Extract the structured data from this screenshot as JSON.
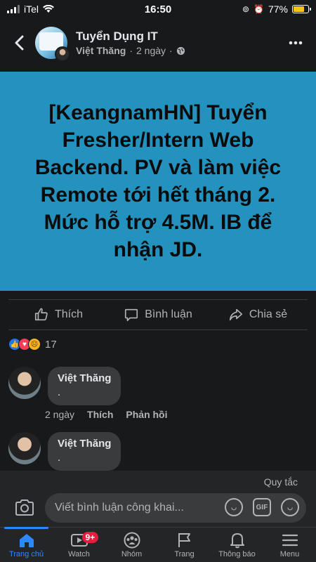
{
  "status_bar": {
    "carrier": "iTel",
    "time": "16:50",
    "battery": "77%",
    "battery_level": 0.77
  },
  "header": {
    "group_name": "Tuyển Dụng IT",
    "author": "Việt Thăng",
    "separator": "·",
    "time_ago": "2 ngày",
    "separator2": "·"
  },
  "post": {
    "text": "[KeangnamHN] Tuyển Fresher/Intern Web Backend. PV và làm việc Remote tới hết tháng 2. Mức hỗ trợ 4.5M. IB để nhận JD.",
    "background_color": "#2492be"
  },
  "actions": {
    "like": "Thích",
    "comment": "Bình luận",
    "share": "Chia sẻ"
  },
  "reactions": {
    "count": "17"
  },
  "comments": [
    {
      "name": "Việt Thăng",
      "text": ".",
      "time": "2 ngày",
      "like": "Thích",
      "reply": "Phản hồi"
    },
    {
      "name": "Việt Thăng",
      "text": "."
    }
  ],
  "comment_box": {
    "rules": "Quy tắc",
    "placeholder": "Viết bình luận công khai...",
    "gif": "GIF"
  },
  "tabs": [
    {
      "label": "Trang chủ",
      "icon": "home-icon"
    },
    {
      "label": "Watch",
      "icon": "watch-icon",
      "badge": "9+"
    },
    {
      "label": "Nhóm",
      "icon": "groups-icon"
    },
    {
      "label": "Trang",
      "icon": "flag-icon"
    },
    {
      "label": "Thông báo",
      "icon": "bell-icon"
    },
    {
      "label": "Menu",
      "icon": "menu-icon"
    }
  ]
}
